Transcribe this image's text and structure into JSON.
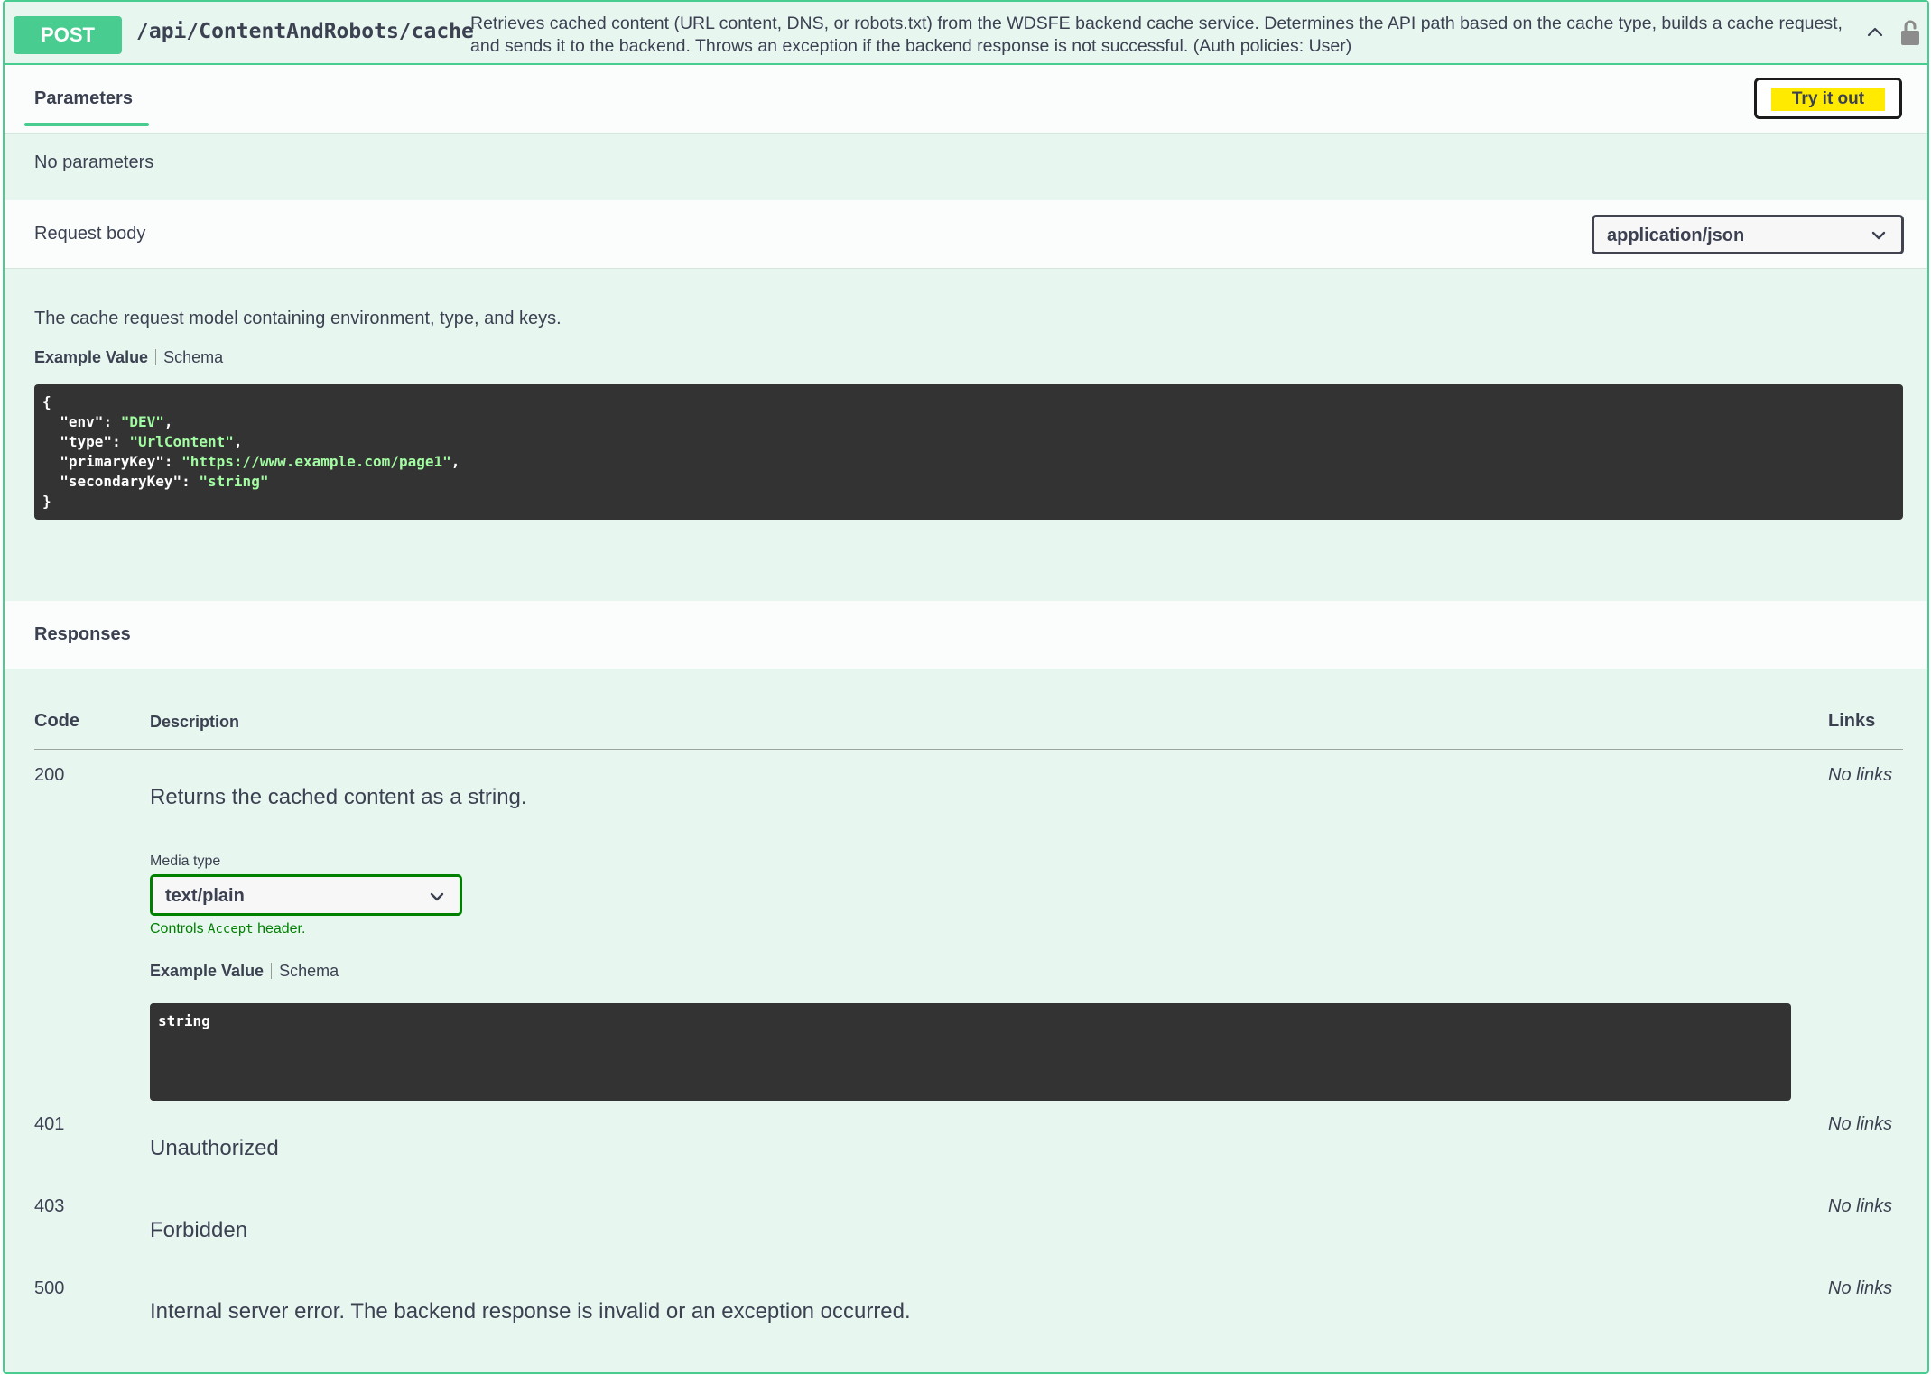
{
  "endpoint": {
    "method": "POST",
    "path": "/api/ContentAndRobots/cache",
    "description": "Retrieves cached content (URL content, DNS, or robots.txt) from the WDSFE backend cache service. Determines the API path based on the cache type, builds a cache request, and sends it to the backend. Throws an exception if the backend response is not successful. (Auth policies: User)"
  },
  "parameters": {
    "tab_label": "Parameters",
    "try_button": "Try it out",
    "empty_text": "No parameters"
  },
  "request_body": {
    "title": "Request body",
    "content_type": "application/json",
    "description": "The cache request model containing environment, type, and keys.",
    "example_tab": "Example Value",
    "schema_tab": "Schema",
    "example": {
      "env": "DEV",
      "type": "UrlContent",
      "primaryKey": "https://www.example.com/page1",
      "secondaryKey": "string"
    }
  },
  "responses": {
    "title": "Responses",
    "columns": {
      "code": "Code",
      "description": "Description",
      "links": "Links"
    },
    "media_type_label": "Media type",
    "media_type": "text/plain",
    "controls_prefix": "Controls",
    "controls_code": "Accept",
    "controls_suffix": "header.",
    "example_tab": "Example Value",
    "schema_tab": "Schema",
    "example_value": "string",
    "rows": [
      {
        "code": "200",
        "description": "Returns the cached content as a string.",
        "links": "No links"
      },
      {
        "code": "401",
        "description": "Unauthorized",
        "links": "No links"
      },
      {
        "code": "403",
        "description": "Forbidden",
        "links": "No links"
      },
      {
        "code": "500",
        "description": "Internal server error. The backend response is invalid or an exception occurred.",
        "links": "No links"
      }
    ]
  },
  "icons": {
    "collapse": "chevron-up-icon",
    "auth": "lock-icon",
    "dropdown": "chevron-down-icon"
  },
  "colors": {
    "post": "#49cc90",
    "post_bg": "#e8f6f0",
    "code_bg": "#333333",
    "accept_green": "#008000",
    "try_highlight": "#ffea00"
  }
}
